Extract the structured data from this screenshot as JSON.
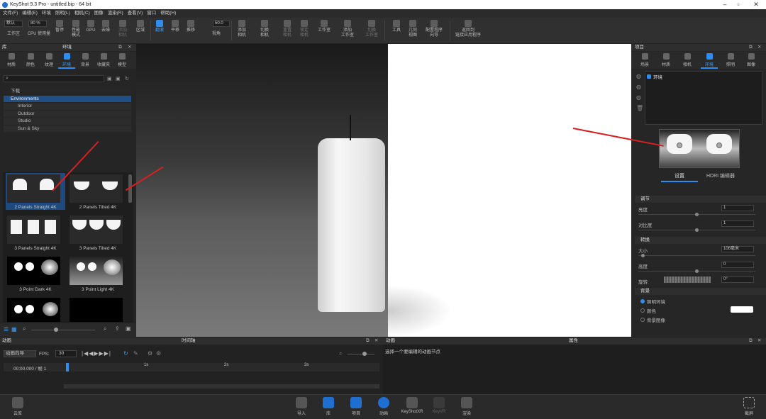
{
  "window": {
    "title": "KeyShot 9.3 Pro  -  untitled.bip  -  64 bit"
  },
  "menu": [
    "文件(F)",
    "编辑(E)",
    "环境",
    "照明(L)",
    "相机(C)",
    "图像",
    "渲染(R)",
    "查看(V)",
    "窗口",
    "帮助(H)"
  ],
  "toolbar": {
    "preset_value": "默认",
    "workspace_label": "工作区",
    "cores_value": "80 %",
    "cpu_label": "CPU 使用量",
    "pause_label": "暂停",
    "perf_mode_label": "性能\n模式",
    "gpu_label": "GPU",
    "denoise_label": "去噪",
    "add_geo_label": "添加\n相机",
    "reflow_label": "区域",
    "refresh_label": "翻滚",
    "pan_label": "平移",
    "push_label": "推移",
    "fov_value": "50.0",
    "view_label": "视角",
    "add_camera_label": "添加\n相机",
    "switch_camera_label": "切换\n相机",
    "reset_camera_label": "重置\n相机",
    "lock_camera_label": "锁定\n相机",
    "studio_label": "工作室",
    "add_studio_label": "添加\n工作室",
    "switch_studio_label": "切换\n工作室",
    "tools_label": "工具",
    "geometry_view_label": "几何\n视图",
    "config_label": "配置程序\n向导",
    "return_link_label": "返回到\n链接应用程序"
  },
  "left_panel": {
    "header_left": "库",
    "header_center": "环境",
    "tabs": [
      "材质",
      "颜色",
      "纹理",
      "环境",
      "背景",
      "收藏夹",
      "模型"
    ],
    "selected_tab": "环境",
    "search_placeholder": "",
    "tree": [
      "下载",
      "Environments",
      "Interior",
      "Outdoor",
      "Studio",
      "Sun & Sky"
    ],
    "thumbnails": [
      "2 Panels Straight 4K",
      "2 Panels Tilted 4K",
      "3 Panels Straight 4K",
      "3 Panels Tilted 4K",
      "3 Point Dark 4K",
      "3 Point Light 4K"
    ]
  },
  "right_panel": {
    "header": "项目",
    "tabs": [
      "场景",
      "材质",
      "相机",
      "环境",
      "照明",
      "图像"
    ],
    "selected_tab": "环境",
    "env_item": "环境",
    "subtabs": [
      "设置",
      "HDRI 编辑器"
    ],
    "sections": {
      "adjust": "调节",
      "brightness_label": "亮度",
      "brightness_value": "1",
      "contrast_label": "对比度",
      "contrast_value": "1",
      "transform": "转换",
      "size_label": "大小",
      "size_value": "106毫米",
      "height_label": "高度",
      "height_value": "0",
      "rotation_label": "旋转:",
      "rotation_value": "0°",
      "background": "背景",
      "bg_opt1": "照明环境",
      "bg_opt2": "颜色",
      "bg_opt3": "背景图像"
    }
  },
  "timeline": {
    "header_left": "动画",
    "header_center": "时间轴",
    "wizard_label": "动画向导",
    "fps_label": "FPS:",
    "fps_value": "30",
    "time_value": "00:00.000 / 帧 1",
    "ticks": [
      "1s",
      "2s",
      "3s"
    ]
  },
  "anim_panel": {
    "header_left": "动画",
    "header_center": "属性",
    "hint": "选择一个要编辑的动画节点"
  },
  "bottom": {
    "cloud_label": "云库",
    "import_label": "导入",
    "library_label": "库",
    "project_label": "项目",
    "animation_label": "动画",
    "keyshotxr_label": "KeyShotXR",
    "keyvr_label": "KeyVR",
    "render_label": "渲染",
    "screenshot_label": "截屏"
  },
  "colors": {
    "accent": "#2f8cf0",
    "arrow": "#d92020"
  }
}
